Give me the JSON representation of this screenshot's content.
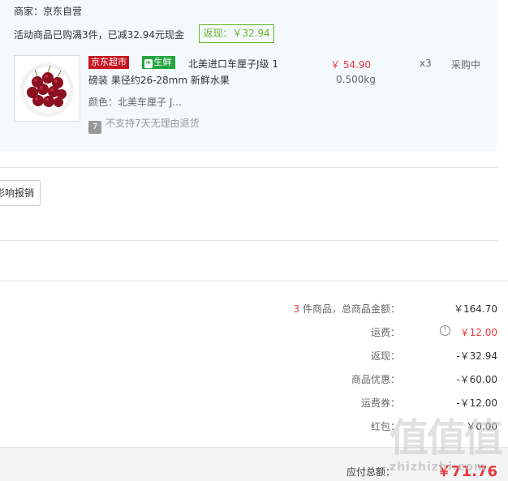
{
  "order": {
    "merchant": "商家：京东自营",
    "promo_text": "活动商品已购满3件，已减32.94元现金",
    "cashback_badge": "返现：￥32.94",
    "product": {
      "tag_jd": "京东超市",
      "tag_fresh": "生鲜",
      "name_line1": "北美进口车厘子J级 1",
      "name_line2": "磅装 果径约26-28mm 新鲜水果",
      "color": "颜色：北美车厘子 J...",
      "no_return_icon_text": "7",
      "no_return": "不支持7天无理由退货",
      "price": "￥ 54.90",
      "weight": "0.500kg",
      "quantity": "x3",
      "status": "采购中"
    }
  },
  "report_button": "影响报销",
  "summary": {
    "count_num": "3",
    "count_label": " 件商品，总商品金额：",
    "total_goods": "￥164.70",
    "shipping_label": "运费：",
    "shipping": "￥12.00",
    "cashback_label": "返现：",
    "cashback": "-￥32.94",
    "discount_label": "商品优惠：",
    "discount": "-￥60.00",
    "shipping_coupon_label": "运费券：",
    "shipping_coupon": "-￥12.00",
    "red_packet_label": "红包：",
    "red_packet": "￥0.00",
    "payable_label": "应付总额：",
    "payable": "￥71.76"
  },
  "watermark": {
    "glyphs": "值值值",
    "text": "zhizhizhi.com"
  },
  "colors": {
    "accent_red": "#e4393c",
    "fresh_green": "#26a640",
    "cashback_green": "#6ab42b",
    "card_bg": "#f3f9fd"
  }
}
